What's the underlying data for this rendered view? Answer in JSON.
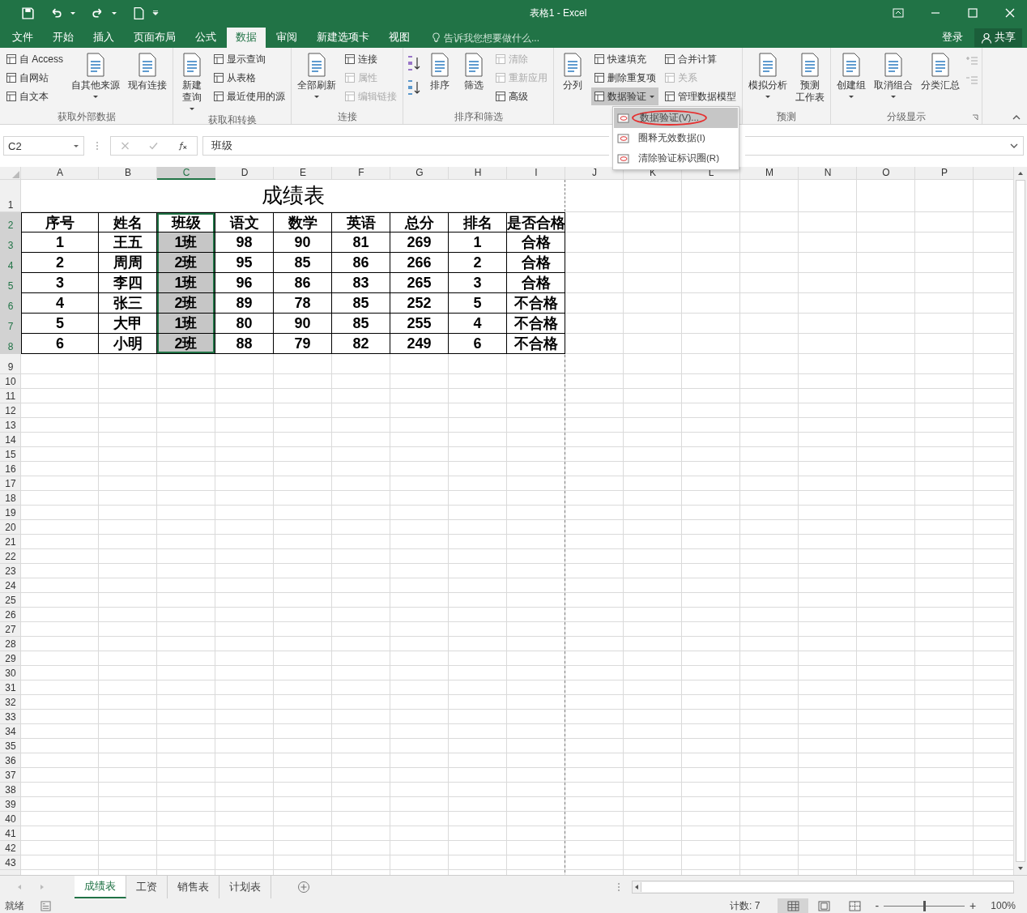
{
  "window": {
    "title": "表格1 - Excel"
  },
  "tabs": [
    {
      "label": "文件",
      "selected": false
    },
    {
      "label": "开始",
      "selected": false
    },
    {
      "label": "插入",
      "selected": false
    },
    {
      "label": "页面布局",
      "selected": false
    },
    {
      "label": "公式",
      "selected": false
    },
    {
      "label": "数据",
      "selected": true
    },
    {
      "label": "审阅",
      "selected": false
    },
    {
      "label": "新建选项卡",
      "selected": false
    },
    {
      "label": "视图",
      "selected": false
    }
  ],
  "tell_me": {
    "placeholder": "告诉我您想要做什么..."
  },
  "account": {
    "sign_in": "登录",
    "share": "共享"
  },
  "ribbon": {
    "groups": [
      {
        "label": "获取外部数据",
        "items": [
          {
            "kind": "stack",
            "buttons": [
              {
                "label": "自 Access",
                "disabled": false,
                "pressed": false,
                "dropdown": false
              },
              {
                "label": "自网站",
                "disabled": false,
                "pressed": false,
                "dropdown": false
              },
              {
                "label": "自文本",
                "disabled": false,
                "pressed": false,
                "dropdown": false
              }
            ]
          },
          {
            "kind": "large",
            "lines": [
              "自其他来源"
            ],
            "dropdown": true
          },
          {
            "kind": "large",
            "lines": [
              "现有连接"
            ],
            "dropdown": false
          }
        ]
      },
      {
        "label": "获取和转换",
        "items": [
          {
            "kind": "large",
            "lines": [
              "新建",
              "查询"
            ],
            "dropdown": true
          },
          {
            "kind": "stack",
            "buttons": [
              {
                "label": "显示查询",
                "disabled": false,
                "pressed": false,
                "dropdown": false
              },
              {
                "label": "从表格",
                "disabled": false,
                "pressed": false,
                "dropdown": false
              },
              {
                "label": "最近使用的源",
                "disabled": false,
                "pressed": false,
                "dropdown": false
              }
            ]
          }
        ]
      },
      {
        "label": "连接",
        "items": [
          {
            "kind": "large",
            "lines": [
              "全部刷新"
            ],
            "dropdown": true
          },
          {
            "kind": "stack",
            "buttons": [
              {
                "label": "连接",
                "disabled": false,
                "pressed": false,
                "dropdown": false
              },
              {
                "label": "属性",
                "disabled": true,
                "pressed": false,
                "dropdown": false
              },
              {
                "label": "编辑链接",
                "disabled": true,
                "pressed": false,
                "dropdown": false
              }
            ]
          }
        ]
      },
      {
        "label": "排序和筛选",
        "items": [
          {
            "kind": "sort_icons"
          },
          {
            "kind": "large",
            "lines": [
              "排序"
            ],
            "dropdown": false
          },
          {
            "kind": "large",
            "lines": [
              "筛选"
            ],
            "dropdown": false
          },
          {
            "kind": "stack",
            "buttons": [
              {
                "label": "清除",
                "disabled": true,
                "pressed": false,
                "dropdown": false
              },
              {
                "label": "重新应用",
                "disabled": true,
                "pressed": false,
                "dropdown": false
              },
              {
                "label": "高级",
                "disabled": false,
                "pressed": false,
                "dropdown": false
              }
            ]
          }
        ]
      },
      {
        "items": [
          {
            "kind": "large",
            "lines": [
              "分列"
            ],
            "dropdown": false
          },
          {
            "kind": "stack",
            "buttons": [
              {
                "label": "快速填充",
                "disabled": false,
                "pressed": false,
                "dropdown": false
              },
              {
                "label": "删除重复项",
                "disabled": false,
                "pressed": false,
                "dropdown": false
              },
              {
                "label": "数据验证",
                "disabled": false,
                "pressed": true,
                "dropdown": true
              }
            ]
          },
          {
            "kind": "stack",
            "buttons": [
              {
                "label": "合并计算",
                "disabled": false,
                "pressed": false,
                "dropdown": false
              },
              {
                "label": "关系",
                "disabled": true,
                "pressed": false,
                "dropdown": false
              },
              {
                "label": "管理数据模型",
                "disabled": false,
                "pressed": false,
                "dropdown": false
              }
            ]
          }
        ]
      },
      {
        "label": "预测",
        "items": [
          {
            "kind": "large",
            "lines": [
              "模拟分析"
            ],
            "dropdown": true
          },
          {
            "kind": "large",
            "lines": [
              "预测",
              "工作表"
            ],
            "dropdown": false
          }
        ]
      },
      {
        "label": "分级显示",
        "launcher": true,
        "items": [
          {
            "kind": "large",
            "lines": [
              "创建组"
            ],
            "dropdown": true
          },
          {
            "kind": "large",
            "lines": [
              "取消组合"
            ],
            "dropdown": true
          },
          {
            "kind": "large",
            "lines": [
              "分类汇总"
            ],
            "dropdown": false
          },
          {
            "kind": "outline_icons"
          }
        ]
      }
    ]
  },
  "dropdown_menu": {
    "items": [
      {
        "label": "数据验证(V)...",
        "selected": true,
        "circled": true
      },
      {
        "label": "圈释无效数据(I)",
        "selected": false,
        "circled": false
      },
      {
        "label": "清除验证标识圈(R)",
        "selected": false,
        "circled": false
      }
    ]
  },
  "formula_bar": {
    "name_box": "C2",
    "value": "班级"
  },
  "sheet": {
    "column_headers": [
      {
        "label": "A",
        "selected": false
      },
      {
        "label": "B",
        "selected": false
      },
      {
        "label": "C",
        "selected": true
      },
      {
        "label": "D",
        "selected": false
      },
      {
        "label": "E",
        "selected": false
      },
      {
        "label": "F",
        "selected": false
      },
      {
        "label": "G",
        "selected": false
      },
      {
        "label": "H",
        "selected": false
      },
      {
        "label": "I",
        "selected": false
      },
      {
        "label": "J",
        "selected": false
      },
      {
        "label": "K",
        "selected": false
      },
      {
        "label": "L",
        "selected": false
      },
      {
        "label": "M",
        "selected": false
      },
      {
        "label": "N",
        "selected": false
      },
      {
        "label": "O",
        "selected": false
      },
      {
        "label": "P",
        "selected": false
      }
    ],
    "row_headers": [
      {
        "label": "1",
        "selected": false
      },
      {
        "label": "2",
        "selected": true
      },
      {
        "label": "3",
        "selected": true
      },
      {
        "label": "4",
        "selected": true
      },
      {
        "label": "5",
        "selected": true
      },
      {
        "label": "6",
        "selected": true
      },
      {
        "label": "7",
        "selected": true
      },
      {
        "label": "8",
        "selected": true
      },
      {
        "label": "9",
        "selected": false
      },
      {
        "label": "10",
        "selected": false
      },
      {
        "label": "11",
        "selected": false
      },
      {
        "label": "12",
        "selected": false
      },
      {
        "label": "13",
        "selected": false
      },
      {
        "label": "14",
        "selected": false
      },
      {
        "label": "15",
        "selected": false
      },
      {
        "label": "16",
        "selected": false
      },
      {
        "label": "17",
        "selected": false
      },
      {
        "label": "18",
        "selected": false
      },
      {
        "label": "19",
        "selected": false
      },
      {
        "label": "20",
        "selected": false
      },
      {
        "label": "21",
        "selected": false
      },
      {
        "label": "22",
        "selected": false
      },
      {
        "label": "23",
        "selected": false
      },
      {
        "label": "24",
        "selected": false
      },
      {
        "label": "25",
        "selected": false
      },
      {
        "label": "26",
        "selected": false
      },
      {
        "label": "27",
        "selected": false
      },
      {
        "label": "28",
        "selected": false
      },
      {
        "label": "29",
        "selected": false
      },
      {
        "label": "30",
        "selected": false
      },
      {
        "label": "31",
        "selected": false
      },
      {
        "label": "32",
        "selected": false
      },
      {
        "label": "33",
        "selected": false
      },
      {
        "label": "34",
        "selected": false
      },
      {
        "label": "35",
        "selected": false
      },
      {
        "label": "36",
        "selected": false
      },
      {
        "label": "37",
        "selected": false
      },
      {
        "label": "38",
        "selected": false
      },
      {
        "label": "39",
        "selected": false
      },
      {
        "label": "40",
        "selected": false
      },
      {
        "label": "41",
        "selected": false
      },
      {
        "label": "42",
        "selected": false
      },
      {
        "label": "43",
        "selected": false
      }
    ],
    "table": {
      "title": "成绩表",
      "header": [
        "序号",
        "姓名",
        "班级",
        "语文",
        "数学",
        "英语",
        "总分",
        "排名",
        "是否合格"
      ],
      "rows": [
        [
          "1",
          "王五",
          "1班",
          "98",
          "90",
          "81",
          "269",
          "1",
          "合格"
        ],
        [
          "2",
          "周周",
          "2班",
          "95",
          "85",
          "86",
          "266",
          "2",
          "合格"
        ],
        [
          "3",
          "李四",
          "1班",
          "96",
          "86",
          "83",
          "265",
          "3",
          "合格"
        ],
        [
          "4",
          "张三",
          "2班",
          "89",
          "78",
          "85",
          "252",
          "5",
          "不合格"
        ],
        [
          "5",
          "大甲",
          "1班",
          "80",
          "90",
          "85",
          "255",
          "4",
          "不合格"
        ],
        [
          "6",
          "小明",
          "2班",
          "88",
          "79",
          "82",
          "249",
          "6",
          "不合格"
        ]
      ]
    }
  },
  "sheet_tabs": [
    {
      "label": "成绩表",
      "selected": true
    },
    {
      "label": "工资",
      "selected": false
    },
    {
      "label": "销售表",
      "selected": false
    },
    {
      "label": "计划表",
      "selected": false
    }
  ],
  "status_bar": {
    "status": "就绪",
    "count": "计数: 7",
    "views": [
      {
        "selected": true
      },
      {
        "selected": false
      },
      {
        "selected": false
      }
    ],
    "zoom": {
      "minus": "-",
      "plus": "+",
      "level": 0.5,
      "reading": "100%"
    }
  }
}
